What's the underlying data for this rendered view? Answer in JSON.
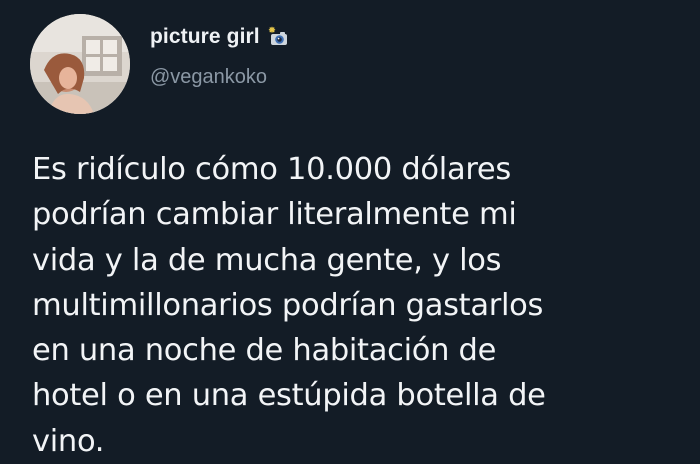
{
  "tweet": {
    "display_name": "picture girl",
    "handle": "@vegankoko",
    "name_emoji": "camera-with-flash-icon",
    "text_lines": [
      "Es ridículo cómo 10.000 dólares",
      "podrían cambiar literalmente mi",
      "vida y la de mucha gente, y los",
      "multimillonarios podrían gastarlos",
      "en una noche de habitación de",
      "hotel o en una estúpida botella de",
      "vino."
    ]
  },
  "colors": {
    "background": "#131c26",
    "display_name": "#eef1f4",
    "handle": "#8b98a5",
    "body_text": "#f2f4f6"
  }
}
